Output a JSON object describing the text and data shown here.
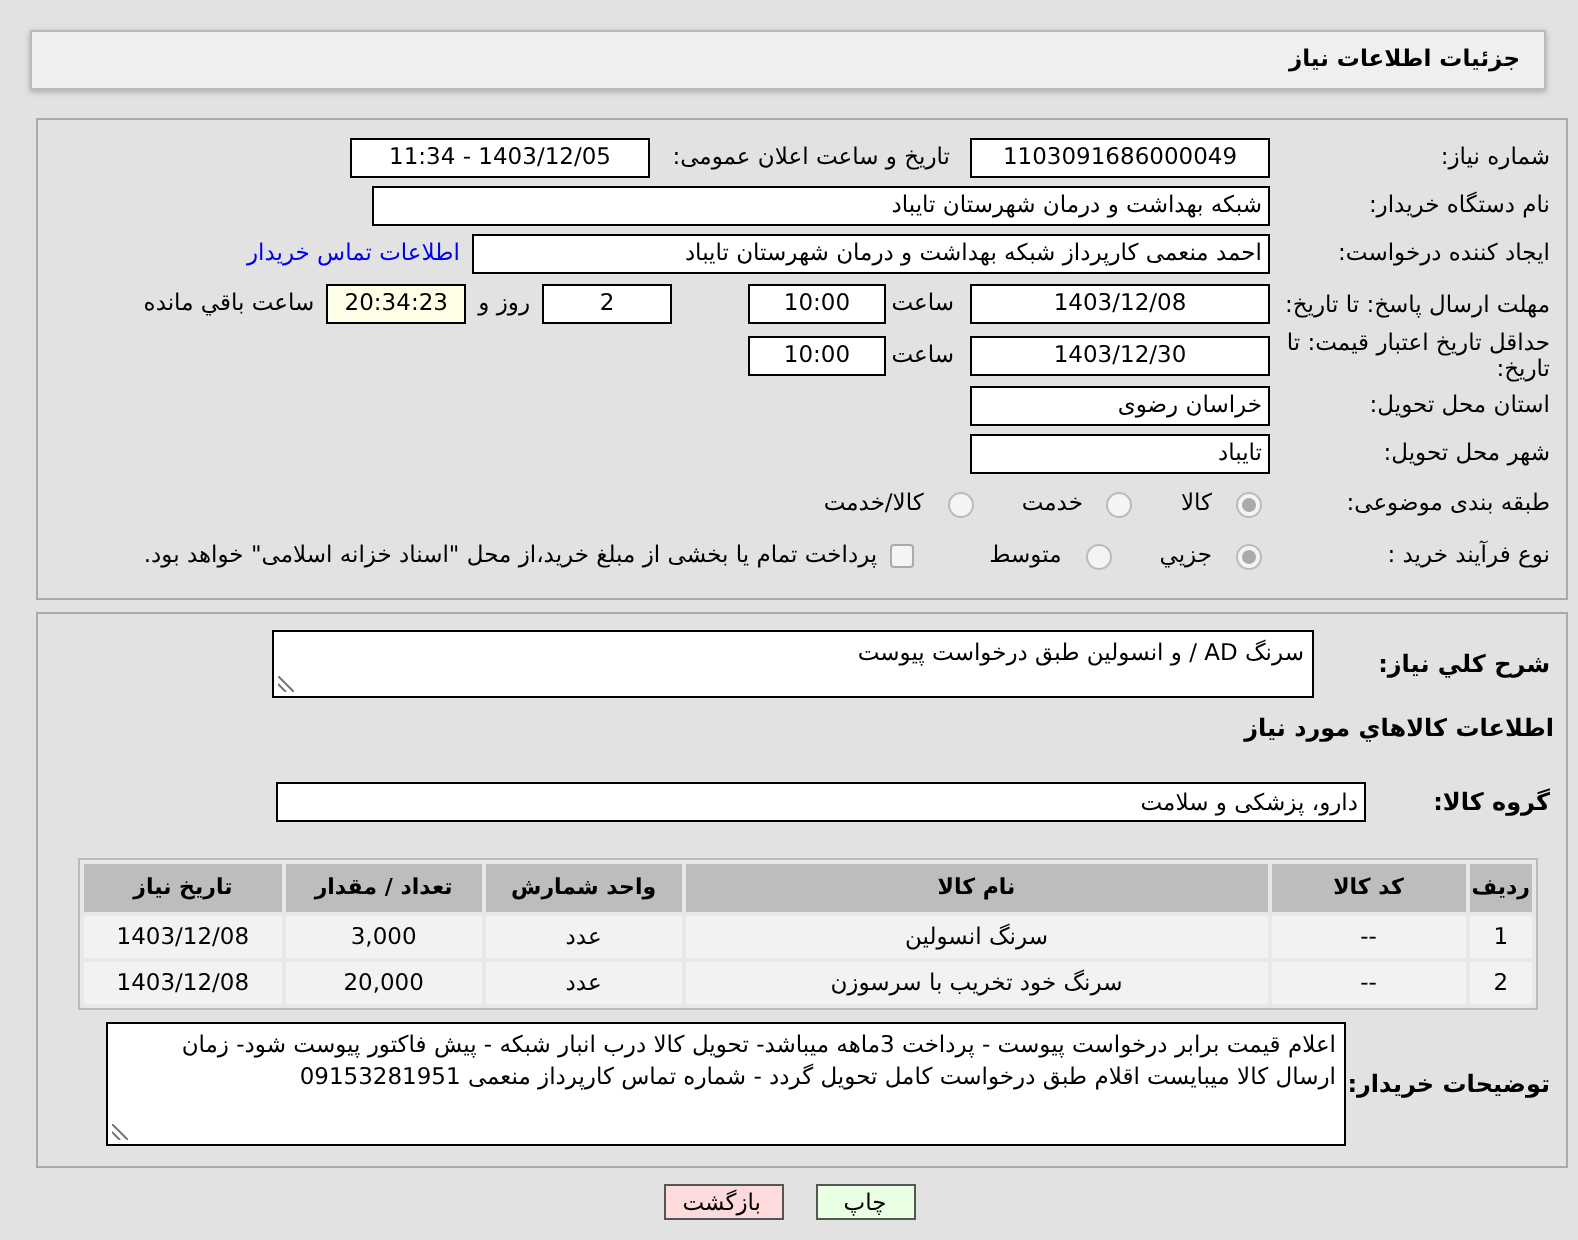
{
  "header": {
    "title": "جزئیات اطلاعات نیاز"
  },
  "fields": [
    {
      "kind": "pair",
      "label": "شماره نیاز:",
      "value": "1103091686000049",
      "label2": "تاریخ و ساعت اعلان عمومی:",
      "value2": "1403/12/05 - 11:34"
    },
    {
      "kind": "wide",
      "label": "نام دستگاه خریدار:",
      "value": "شبکه بهداشت و درمان شهرستان تایباد"
    },
    {
      "kind": "link",
      "label": "ایجاد کننده درخواست:",
      "value": "احمد منعمی کارپرداز شبکه بهداشت و درمان شهرستان تایباد",
      "link": "اطلاعات تماس خریدار"
    },
    {
      "kind": "deadline",
      "label": "مهلت ارسال پاسخ: تا تاریخ:",
      "value": "1403/12/08",
      "time_label": "ساعت",
      "time": "10:00",
      "days": "2",
      "days_label": "روز و",
      "remaining": "20:34:23",
      "remaining_label": "ساعت باقي مانده"
    },
    {
      "kind": "date",
      "label": "حداقل تاریخ اعتبار قیمت: تا تاریخ:",
      "value": "1403/12/30",
      "time_label": "ساعت",
      "time": "10:00"
    },
    {
      "kind": "short",
      "label": "استان محل تحویل:",
      "value": "خراسان رضوی"
    },
    {
      "kind": "short",
      "label": "شهر محل تحویل:",
      "value": "تایباد"
    }
  ],
  "category": {
    "label": "طبقه بندی موضوعی:",
    "options": [
      {
        "label": "کالا",
        "selected": true
      },
      {
        "label": "خدمت",
        "selected": false
      },
      {
        "label": "کالا/خدمت",
        "selected": false
      }
    ]
  },
  "process": {
    "label": "نوع فرآیند خرید :",
    "options": [
      {
        "label": "جزیي",
        "selected": true
      },
      {
        "label": "متوسط",
        "selected": false
      }
    ],
    "treasury": {
      "checked": false,
      "text": "پرداخت تمام یا بخشی از مبلغ خرید،از محل \"اسناد خزانه اسلامی\" خواهد بود."
    }
  },
  "description": {
    "label": "شرح کلي نیاز:",
    "value": "سرنگ AD / و انسولین طبق درخواست پیوست"
  },
  "goods_heading": "اطلاعات کالاهاي مورد نياز",
  "goods_group": {
    "label": "گروه کالا:",
    "value": "دارو، پزشکی و سلامت"
  },
  "table": {
    "columns": [
      "ردیف",
      "کد کالا",
      "نام کالا",
      "واحد شمارش",
      "تعداد / مقدار",
      "تاریخ نیاز"
    ],
    "rows": [
      [
        "1",
        "--",
        "سرنگ انسولین",
        "عدد",
        "3,000",
        "1403/12/08"
      ],
      [
        "2",
        "--",
        "سرنگ خود تخریب با سرسوزن",
        "عدد",
        "20,000",
        "1403/12/08"
      ]
    ]
  },
  "buyer_notes": {
    "label": "توضیحات خریدار:",
    "value": "اعلام قیمت برابر درخواست پیوست  - پرداخت 3ماهه میباشد- تحویل کالا درب انبار شبکه - پیش فاکتور پیوست شود- زمان ارسال کالا میبایست اقلام طبق درخواست  کامل تحویل گردد - شماره تماس کارپرداز منعمی 09153281951"
  },
  "buttons": [
    {
      "kind": "print",
      "label": "چاپ"
    },
    {
      "kind": "back",
      "label": "بازگشت"
    }
  ]
}
